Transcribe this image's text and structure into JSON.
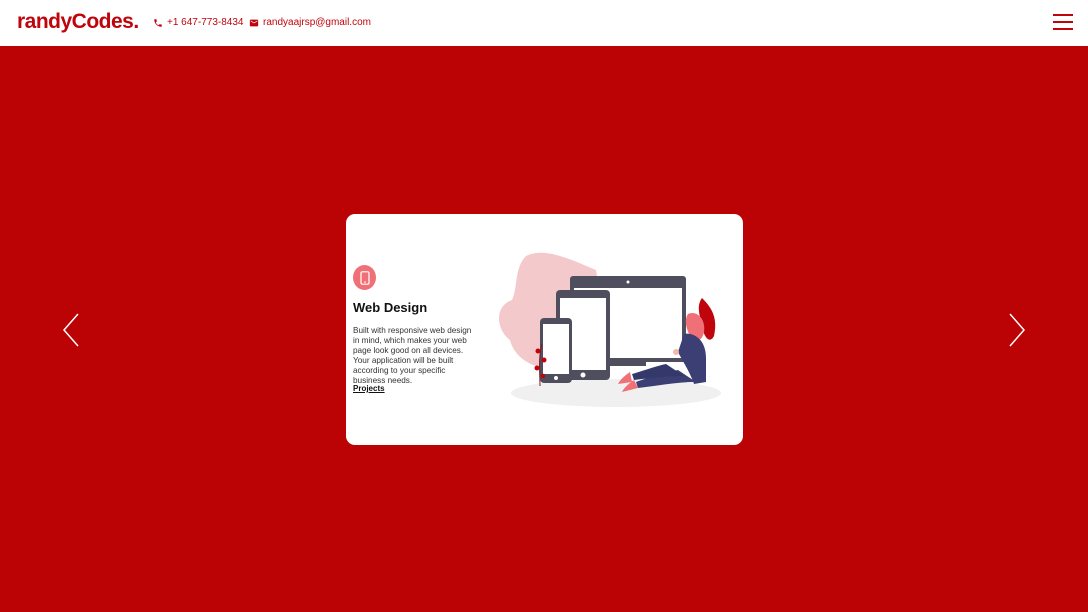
{
  "header": {
    "brand": "randyCodes.",
    "phone": "+1 647-773-8434",
    "email": "randyaajrsp@gmail.com",
    "phone_icon": "phone-icon",
    "email_icon": "mail-icon",
    "menu_icon": "hamburger-menu-icon"
  },
  "carousel": {
    "prev_icon": "chevron-left-icon",
    "next_icon": "chevron-right-icon",
    "card": {
      "icon": "smartphone-icon",
      "title": "Web Design",
      "description": "Built with responsive web design in mind, which makes your web page look good on all devices. Your application will be built according to your specific business needs.",
      "link_label": "Projects"
    }
  },
  "colors": {
    "brand": "#c0040b",
    "hero_background": "#bb0306",
    "icon_circle": "#f07078",
    "card_background": "#ffffff"
  }
}
